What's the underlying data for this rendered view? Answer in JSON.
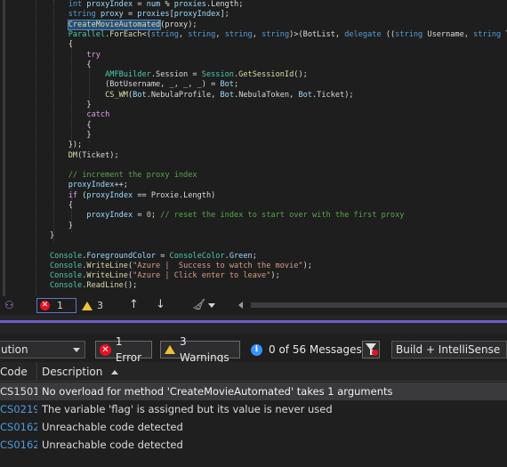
{
  "code_lines": [
    [
      [
        "    ",
        ""
      ],
      [
        "int",
        "kw"
      ],
      [
        " ",
        ""
      ],
      [
        "proxyIndex",
        "id"
      ],
      [
        " = ",
        ""
      ],
      [
        "num",
        "id"
      ],
      [
        " % ",
        ""
      ],
      [
        "proxies",
        "id"
      ],
      [
        ".Length;",
        ""
      ]
    ],
    [
      [
        "    ",
        ""
      ],
      [
        "string",
        "kw"
      ],
      [
        " ",
        ""
      ],
      [
        "proxy",
        "id"
      ],
      [
        " = ",
        ""
      ],
      [
        "proxies",
        "id"
      ],
      [
        "[",
        ""
      ],
      [
        "proxyIndex",
        "id"
      ],
      [
        "];",
        ""
      ]
    ],
    [
      [
        "    ",
        ""
      ],
      [
        "CreateMovieAutomated",
        "fn hl"
      ],
      [
        "(proxy);",
        ""
      ]
    ],
    [
      [
        "    ",
        ""
      ],
      [
        "Parallel",
        "ty"
      ],
      [
        ".",
        ""
      ],
      [
        "ForEach",
        "fn"
      ],
      [
        "<(",
        ""
      ],
      [
        "string",
        "kw"
      ],
      [
        ", ",
        ""
      ],
      [
        "string",
        "kw"
      ],
      [
        ", ",
        ""
      ],
      [
        "string",
        "kw"
      ],
      [
        ", ",
        ""
      ],
      [
        "string",
        "kw"
      ],
      [
        ")>(BotList, ",
        ""
      ],
      [
        "delegate",
        "kw"
      ],
      [
        " ((",
        ""
      ],
      [
        "string",
        "kw"
      ],
      [
        " Username, ",
        ""
      ],
      [
        "string",
        "kw"
      ],
      [
        " T",
        ""
      ]
    ],
    [
      [
        "    {",
        ""
      ]
    ],
    [
      [
        "        ",
        ""
      ],
      [
        "try",
        "ctl"
      ]
    ],
    [
      [
        "        {",
        ""
      ]
    ],
    [
      [
        "            ",
        ""
      ],
      [
        "AMFBuilder",
        "ty"
      ],
      [
        ".Session = ",
        ""
      ],
      [
        "Session",
        "ty"
      ],
      [
        ".",
        ""
      ],
      [
        "GetSessionId",
        "fn"
      ],
      [
        "();",
        ""
      ]
    ],
    [
      [
        "            (BotUsername, _, _, _) = ",
        ""
      ],
      [
        "Bot",
        "id"
      ],
      [
        ";",
        ""
      ]
    ],
    [
      [
        "            ",
        ""
      ],
      [
        "CS_WM",
        "fn"
      ],
      [
        "(",
        ""
      ],
      [
        "Bot",
        "id"
      ],
      [
        ".NebulaProfile, ",
        ""
      ],
      [
        "Bot",
        "id"
      ],
      [
        ".NebulaToken, ",
        ""
      ],
      [
        "Bot",
        "id"
      ],
      [
        ".Ticket);",
        ""
      ]
    ],
    [
      [
        "        }",
        ""
      ]
    ],
    [
      [
        "        ",
        ""
      ],
      [
        "catch",
        "ctl"
      ]
    ],
    [
      [
        "        {",
        ""
      ]
    ],
    [
      [
        "        }",
        ""
      ]
    ],
    [
      [
        "    });",
        ""
      ]
    ],
    [
      [
        "    ",
        ""
      ],
      [
        "DM",
        "fn"
      ],
      [
        "(Ticket);",
        ""
      ]
    ],
    [
      [
        "",
        ""
      ]
    ],
    [
      [
        "    ",
        ""
      ],
      [
        "// increment the proxy index",
        "cm"
      ]
    ],
    [
      [
        "    ",
        ""
      ],
      [
        "proxyIndex",
        "id"
      ],
      [
        "++;",
        ""
      ]
    ],
    [
      [
        "    ",
        ""
      ],
      [
        "if",
        "ctl"
      ],
      [
        " (",
        ""
      ],
      [
        "proxyIndex",
        "id"
      ],
      [
        " == Proxie.Length)",
        ""
      ]
    ],
    [
      [
        "    {",
        ""
      ]
    ],
    [
      [
        "        ",
        ""
      ],
      [
        "proxyIndex",
        "id"
      ],
      [
        " = ",
        ""
      ],
      [
        "0",
        "nm"
      ],
      [
        "; ",
        ""
      ],
      [
        "// reset the index to start over with the first proxy",
        "cm"
      ]
    ],
    [
      [
        "    }",
        ""
      ]
    ],
    [
      [
        "}",
        ""
      ]
    ],
    [
      [
        "",
        ""
      ]
    ],
    [
      [
        "",
        ""
      ],
      [
        "Console",
        "ty"
      ],
      [
        ".",
        ""
      ],
      [
        "ForegroundColor",
        "id"
      ],
      [
        " = ",
        ""
      ],
      [
        "ConsoleColor",
        "ty"
      ],
      [
        ".",
        ""
      ],
      [
        "Green",
        "id"
      ],
      [
        ";",
        ""
      ]
    ],
    [
      [
        "",
        ""
      ],
      [
        "Console",
        "ty"
      ],
      [
        ".",
        ""
      ],
      [
        "WriteLine",
        "fn"
      ],
      [
        "(",
        ""
      ],
      [
        "\"Azure |  Success to watch the movie\"",
        "st"
      ],
      [
        ");",
        ""
      ]
    ],
    [
      [
        "",
        ""
      ],
      [
        "Console",
        "ty"
      ],
      [
        ".",
        ""
      ],
      [
        "WriteLine",
        "fn"
      ],
      [
        "(",
        ""
      ],
      [
        "\"Azure | Click enter to leave\"",
        "st"
      ],
      [
        ");",
        ""
      ]
    ],
    [
      [
        "",
        ""
      ],
      [
        "Console",
        "ty"
      ],
      [
        ".",
        ""
      ],
      [
        "ReadLine",
        "fn"
      ],
      [
        "();",
        ""
      ]
    ]
  ],
  "editor_status": {
    "error_count": "1",
    "warning_count": "3"
  },
  "error_list": {
    "scope": "ution",
    "errors_label": "1 Error",
    "warnings_label": "3 Warnings",
    "messages_label": "0 of 56 Messages",
    "build_filter": "Build + IntelliSense",
    "columns": {
      "code": "Code",
      "description": "Description"
    },
    "rows": [
      {
        "code": "CS1501",
        "description": "No overload for method 'CreateMovieAutomated' takes 1 arguments",
        "selected": true
      },
      {
        "code": "CS0219",
        "description": "The variable 'flag' is assigned but its value is never used",
        "selected": false
      },
      {
        "code": "CS0162",
        "description": "Unreachable code detected",
        "selected": false
      },
      {
        "code": "CS0162",
        "description": "Unreachable code detected",
        "selected": false
      }
    ]
  },
  "colors": {
    "keyword": "#569cd6",
    "control": "#d8a0df",
    "type": "#4ec9b0",
    "identifier": "#9cdcfe",
    "method": "#dcdcaa",
    "string": "#d69d85",
    "comment": "#57a64a",
    "error": "#e81123",
    "warning": "#f2c037",
    "info": "#3794ff",
    "accent": "#6c5fc7"
  }
}
